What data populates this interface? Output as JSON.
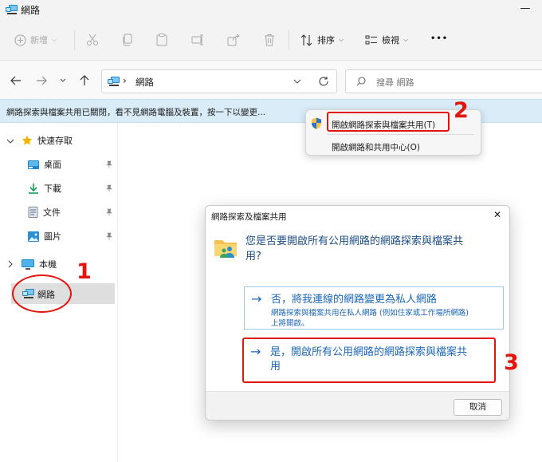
{
  "window": {
    "title": "網路",
    "minimize_glyph": "—"
  },
  "toolbar": {
    "new_label": "新增",
    "sort_label": "排序",
    "view_label": "檢視",
    "more_glyph": "•••",
    "icons": [
      "plus-icon",
      "cut-icon",
      "copy-icon",
      "paste-icon",
      "rename-icon",
      "share-icon",
      "delete-icon",
      "sort-icon",
      "view-icon"
    ]
  },
  "address": {
    "location": "網路",
    "separator": "›",
    "search_placeholder": "搜尋 網路"
  },
  "infobar": {
    "message": "網路探索與檔案共用已關閉，看不見網路電腦及裝置，按一下以變更..."
  },
  "sidebar": {
    "quick_access": "快速存取",
    "items": [
      {
        "label": "桌面",
        "icon": "desktop-icon",
        "pinned": true
      },
      {
        "label": "下載",
        "icon": "download-icon",
        "pinned": true
      },
      {
        "label": "文件",
        "icon": "document-icon",
        "pinned": true
      },
      {
        "label": "圖片",
        "icon": "picture-icon",
        "pinned": true
      }
    ],
    "this_pc": "本機",
    "network": "網路"
  },
  "context_menu": {
    "items": [
      {
        "label": "開啟網路探索與檔案共用(T)",
        "icon": "shield-icon"
      },
      {
        "label": "開啟網路和共用中心(O)"
      }
    ]
  },
  "dialog": {
    "title": "網路探索及檔案共用",
    "close_glyph": "✕",
    "question": "您是否要開啟所有公用網路的網路探索與檔案共用?",
    "question_line1": "您是否要開啟所有公用網路的網路探索與檔案共",
    "question_line2": "用?",
    "option1_title": "否，將我連線的網路變更為私人網路",
    "option1_desc_line1": "網路探索與檔案共用在私人網路 (例如住家或工作場所網路)",
    "option1_desc_line2": "上將開啟。",
    "option2_title_line1": "是，開啟所有公用網路的網路探索與檔案共",
    "option2_title_line2": "用",
    "arrow_glyph": "→",
    "cancel_label": "取消"
  },
  "annotations": {
    "step1": "1",
    "step2": "2",
    "step3": "3",
    "color": "#e2150c"
  },
  "colors": {
    "accent": "#1d67b8",
    "infobar_bg": "#d9ecf8",
    "selection_bg": "#dedede"
  }
}
